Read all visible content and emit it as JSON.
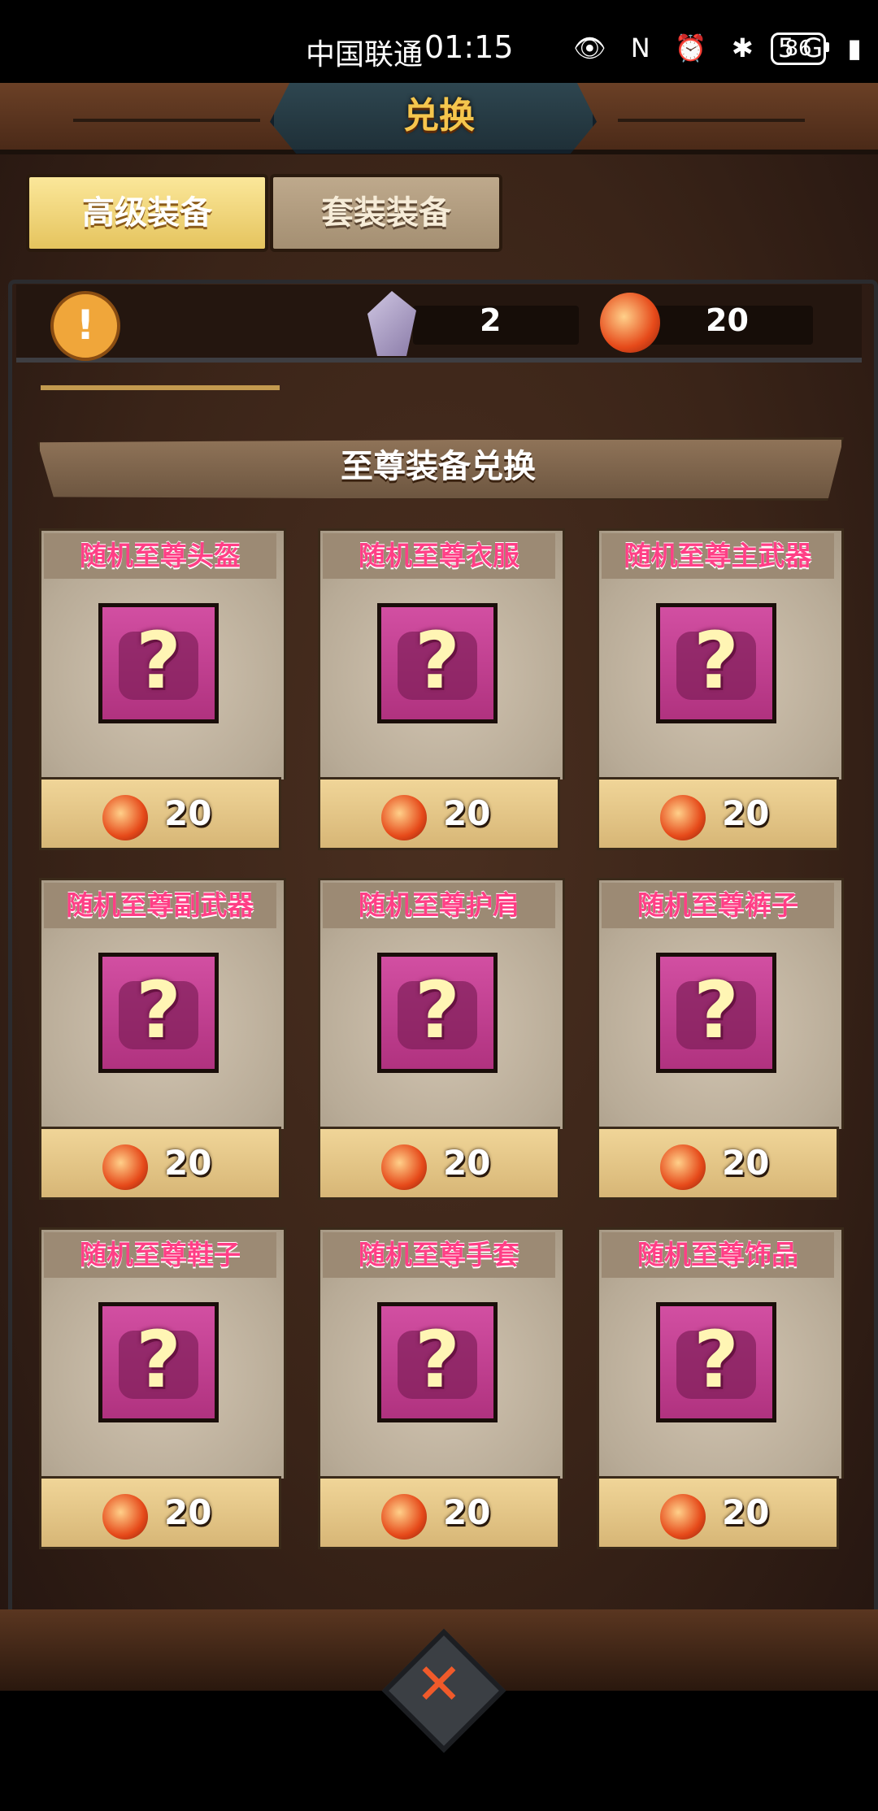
{
  "status_bar": {
    "carrier": "中国联通",
    "time": "01:15",
    "icons": "👁 N ⏰ ✱ 5G ▮",
    "battery": "86"
  },
  "title": "兑换",
  "tabs": [
    {
      "label": "高级装备",
      "active": true
    },
    {
      "label": "套装装备",
      "active": false
    }
  ],
  "resources": {
    "crystal_count": "2",
    "ore_count": "20"
  },
  "section_title": "至尊装备兑换",
  "items": [
    {
      "name": "随机至尊头盔",
      "price": "20"
    },
    {
      "name": "随机至尊衣服",
      "price": "20"
    },
    {
      "name": "随机至尊主武器",
      "price": "20"
    },
    {
      "name": "随机至尊副武器",
      "price": "20"
    },
    {
      "name": "随机至尊护肩",
      "price": "20"
    },
    {
      "name": "随机至尊裤子",
      "price": "20"
    },
    {
      "name": "随机至尊鞋子",
      "price": "20"
    },
    {
      "name": "随机至尊手套",
      "price": "20"
    },
    {
      "name": "随机至尊饰品",
      "price": "20"
    }
  ],
  "item_glyph": "?",
  "alert_glyph": "!",
  "close_glyph": "✕",
  "colors": {
    "item_title": "#ff3f86",
    "tab_active": "#e5c45e",
    "icon_bg": "#c04090"
  }
}
